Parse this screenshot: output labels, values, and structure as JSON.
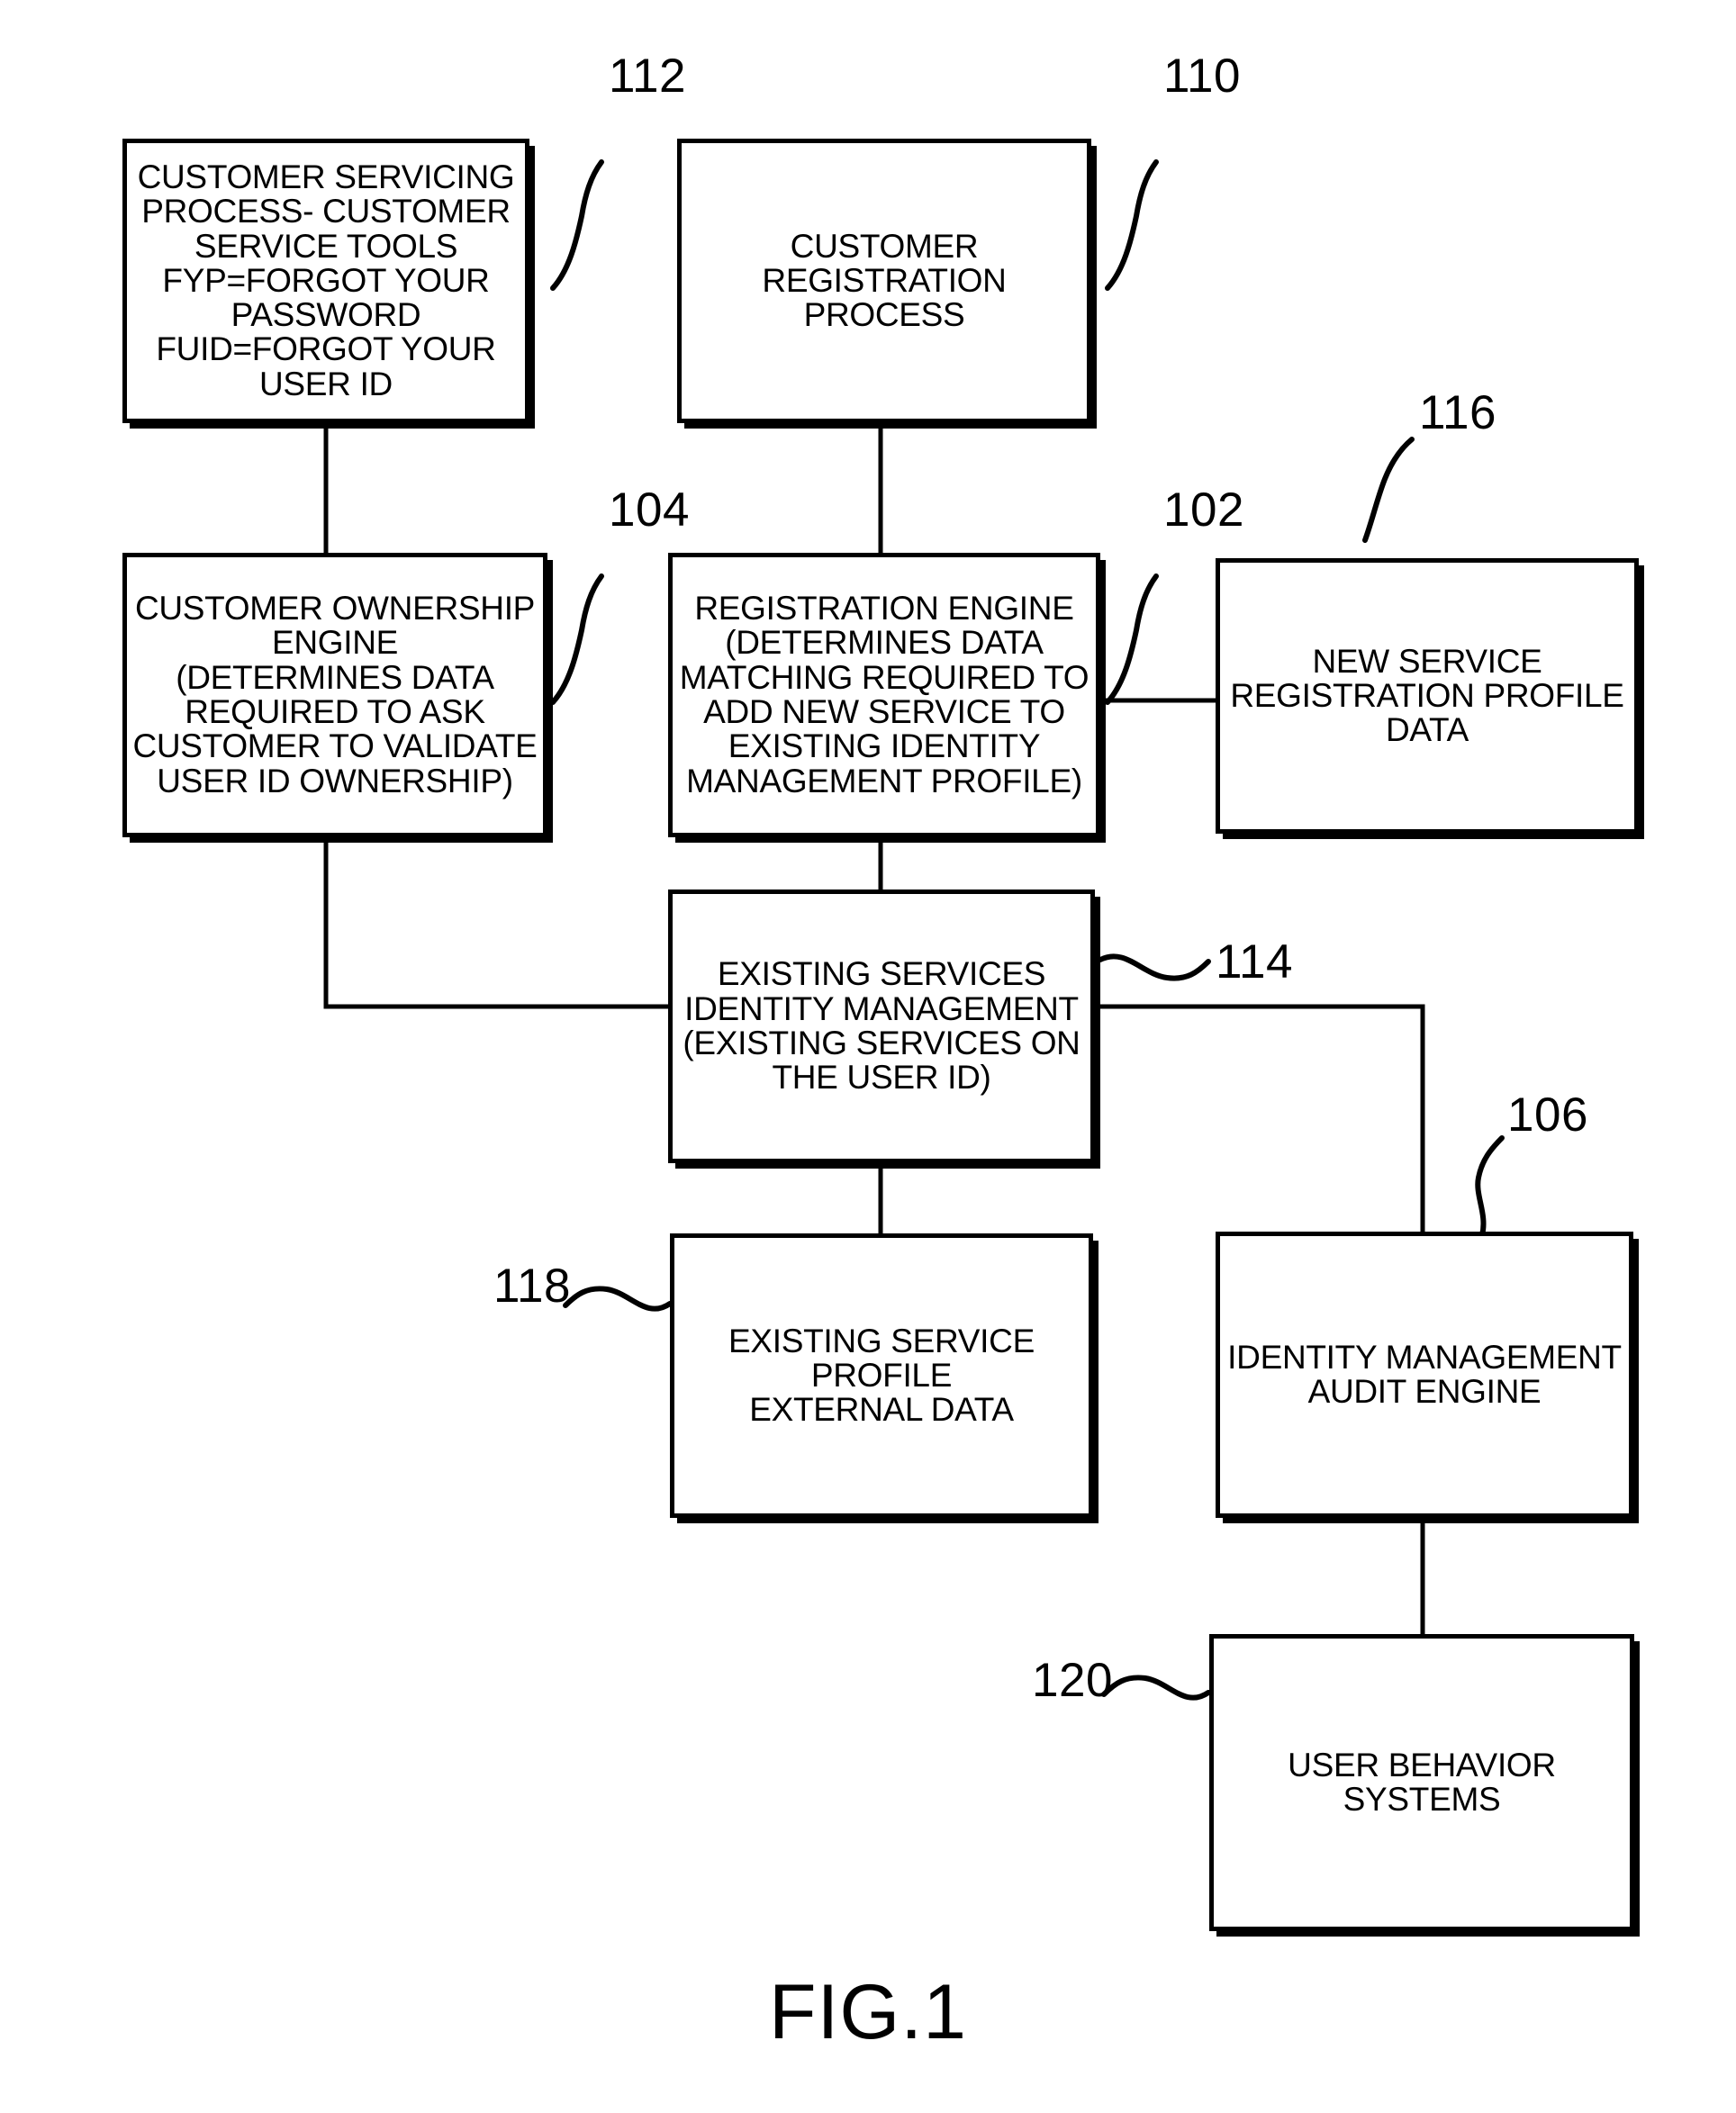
{
  "figure": {
    "caption": "FIG.1",
    "nodes": [
      {
        "ref": "112",
        "name": "customer-servicing-process",
        "text": "CUSTOMER SERVICING\nPROCESS- CUSTOMER\nSERVICE TOOLS\nFYP=FORGOT YOUR\nPASSWORD\nFUID=FORGOT YOUR\nUSER ID"
      },
      {
        "ref": "110",
        "name": "customer-registration-process",
        "text": "CUSTOMER\nREGISTRATION\nPROCESS"
      },
      {
        "ref": "104",
        "name": "customer-ownership-engine",
        "text": "CUSTOMER OWNERSHIP\nENGINE\n(DETERMINES DATA\nREQUIRED TO ASK\nCUSTOMER TO VALIDATE\nUSER ID OWNERSHIP)"
      },
      {
        "ref": "102",
        "name": "registration-engine",
        "text": "REGISTRATION ENGINE\n(DETERMINES DATA\nMATCHING REQUIRED TO\nADD NEW SERVICE TO\nEXISTING IDENTITY\nMANAGEMENT PROFILE)"
      },
      {
        "ref": "116",
        "name": "new-service-registration-profile-data",
        "text": "NEW SERVICE\nREGISTRATION PROFILE\nDATA"
      },
      {
        "ref": "114",
        "name": "existing-services-identity-management",
        "text": "EXISTING SERVICES\nIDENTITY MANAGEMENT\n(EXISTING SERVICES ON\nTHE USER ID)"
      },
      {
        "ref": "118",
        "name": "existing-service-profile-external-data",
        "text": "EXISTING SERVICE\nPROFILE\nEXTERNAL DATA"
      },
      {
        "ref": "106",
        "name": "identity-management-audit-engine",
        "text": "IDENTITY MANAGEMENT\nAUDIT ENGINE"
      },
      {
        "ref": "120",
        "name": "user-behavior-systems",
        "text": "USER BEHAVIOR\nSYSTEMS"
      }
    ],
    "colors": {
      "ink": "#000000",
      "paper": "#ffffff"
    }
  }
}
